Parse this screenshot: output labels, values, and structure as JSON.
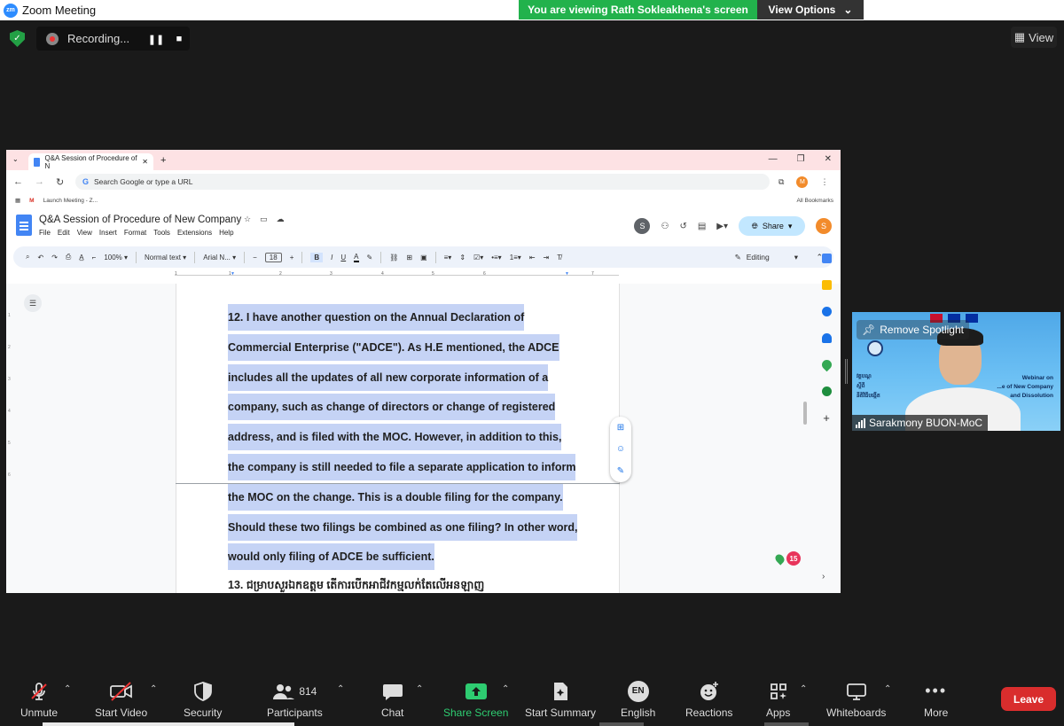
{
  "app": {
    "window_title": "Zoom Meeting",
    "logo_text": "zm",
    "viewing_banner": "You are viewing Rath Sokleakhena's screen",
    "view_options": "View Options",
    "recording_label": "Recording...",
    "view_label": "View"
  },
  "browser": {
    "tab_title": "Q&A Session of Procedure of N",
    "address_placeholder": "Search Google or type a URL",
    "bookmark_item": "Launch Meeting - Z...",
    "all_bookmarks": "All Bookmarks",
    "profile_initial": "M"
  },
  "docs": {
    "title": "Q&A Session of Procedure of New Company",
    "menu": [
      "File",
      "Edit",
      "View",
      "Insert",
      "Format",
      "Tools",
      "Extensions",
      "Help"
    ],
    "share_label": "Share",
    "user_initial": "S",
    "collab_initial": "S",
    "zoom": "100%",
    "style": "Normal text",
    "font": "Arial N...",
    "font_size": "18",
    "mode": "Editing",
    "ruler_numbers": [
      "1",
      "1",
      "2",
      "3",
      "4",
      "5",
      "6",
      "7"
    ],
    "left_ruler_numbers": [
      "1",
      "2",
      "3",
      "4",
      "5",
      "6"
    ],
    "paragraph_12_lines": [
      "12. I have another question on the Annual Declaration of",
      "Commercial Enterprise (\"ADCE\"). As H.E mentioned, the ADCE",
      "includes all the updates of all new corporate information of a",
      "company, such as change of directors or change of registered",
      "address, and is filed with the MOC. However, in addition to this,",
      "the company is still needed to file a separate application to inform",
      "the MOC on the change. This is a double filing for the company.",
      "Should these two filings be combined as one filing? In other word,",
      "would only filing of ADCE be sufficient."
    ],
    "paragraph_13": "13. ជម្រាបសួរឯកឧត្តម តើការបើកអាជីវកម្មលក់តែលើអនឡាញ",
    "notification_count": "15"
  },
  "spotlight": {
    "remove_label": "Remove Spotlight",
    "participant_name": "Sarakmony BUON-MoC",
    "banner_line1": "Webinar on",
    "banner_line2": "...e of New Company",
    "banner_line3": "and Dissolution"
  },
  "toolbar": {
    "unmute": "Unmute",
    "start_video": "Start Video",
    "security": "Security",
    "participants": "Participants",
    "participants_count": "814",
    "chat": "Chat",
    "share_screen": "Share Screen",
    "start_summary": "Start Summary",
    "language": "English",
    "language_code": "EN",
    "reactions": "Reactions",
    "apps": "Apps",
    "whiteboards": "Whiteboards",
    "more": "More",
    "leave": "Leave"
  },
  "colors": {
    "accent_green": "#22b24c",
    "leave_red": "#d92d2d",
    "selection": "#c5d3f5"
  }
}
